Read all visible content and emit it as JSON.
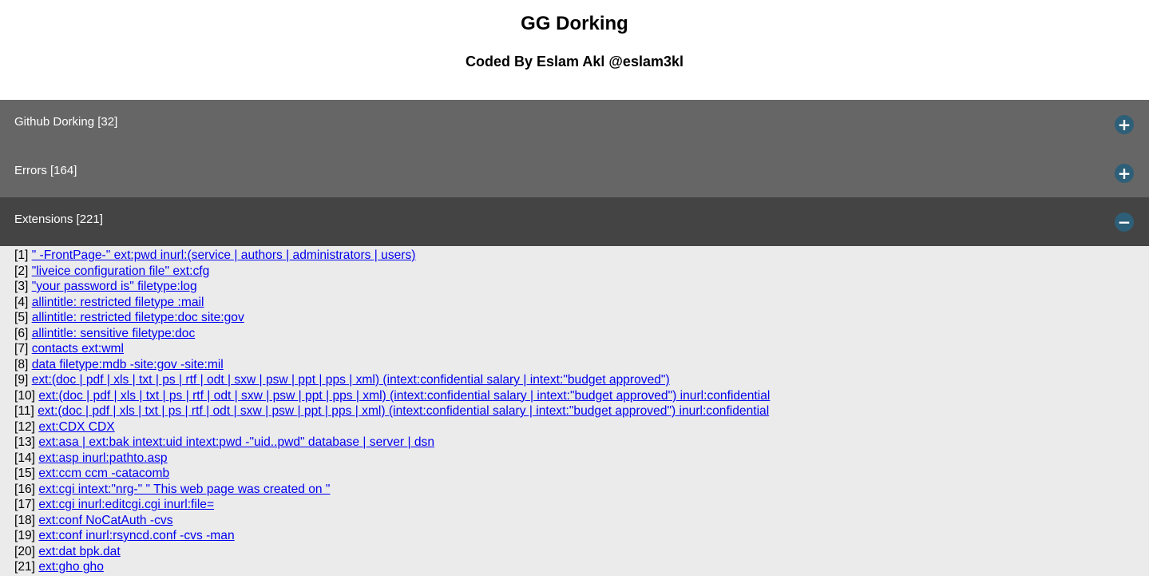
{
  "header": {
    "title": "GG Dorking",
    "subtitle": "Coded By Eslam Akl @eslam3kl"
  },
  "sections": [
    {
      "label": "Github Dorking [32]",
      "toggle": "+"
    },
    {
      "label": "Errors [164]",
      "toggle": "+"
    },
    {
      "label": "Extensions [221]",
      "toggle": "−"
    }
  ],
  "extensions": [
    {
      "index": "[1]",
      "query": "\" -FrontPage-\" ext:pwd inurl:(service | authors | administrators | users)"
    },
    {
      "index": "[2]",
      "query": "\"liveice configuration file\" ext:cfg"
    },
    {
      "index": "[3]",
      "query": "\"your password is\" filetype:log"
    },
    {
      "index": "[4]",
      "query": "allintitle: restricted filetype :mail"
    },
    {
      "index": "[5]",
      "query": "allintitle: restricted filetype:doc site:gov"
    },
    {
      "index": "[6]",
      "query": "allintitle: sensitive filetype:doc"
    },
    {
      "index": "[7]",
      "query": "contacts ext:wml"
    },
    {
      "index": "[8]",
      "query": "data filetype:mdb -site:gov -site:mil"
    },
    {
      "index": "[9]",
      "query": "ext:(doc | pdf | xls | txt | ps | rtf | odt | sxw | psw | ppt | pps | xml) (intext:confidential salary | intext:\"budget approved\")"
    },
    {
      "index": "[10]",
      "query": "ext:(doc | pdf | xls | txt | ps | rtf | odt | sxw | psw | ppt | pps | xml) (intext:confidential salary | intext:\"budget approved\") inurl:confidential"
    },
    {
      "index": "[11]",
      "query": "ext:(doc | pdf | xls | txt | ps | rtf | odt | sxw | psw | ppt | pps | xml) (intext:confidential salary | intext:\"budget approved\") inurl:confidential"
    },
    {
      "index": "[12]",
      "query": "ext:CDX CDX"
    },
    {
      "index": "[13]",
      "query": "ext:asa | ext:bak intext:uid intext:pwd -\"uid..pwd\" database | server | dsn"
    },
    {
      "index": "[14]",
      "query": "ext:asp inurl:pathto.asp"
    },
    {
      "index": "[15]",
      "query": "ext:ccm ccm -catacomb"
    },
    {
      "index": "[16]",
      "query": "ext:cgi intext:\"nrg-\" \" This web page was created on \""
    },
    {
      "index": "[17]",
      "query": "ext:cgi inurl:editcgi.cgi inurl:file="
    },
    {
      "index": "[18]",
      "query": "ext:conf NoCatAuth -cvs"
    },
    {
      "index": "[19]",
      "query": "ext:conf inurl:rsyncd.conf -cvs -man"
    },
    {
      "index": "[20]",
      "query": "ext:dat bpk.dat"
    },
    {
      "index": "[21]",
      "query": "ext:gho gho"
    }
  ]
}
